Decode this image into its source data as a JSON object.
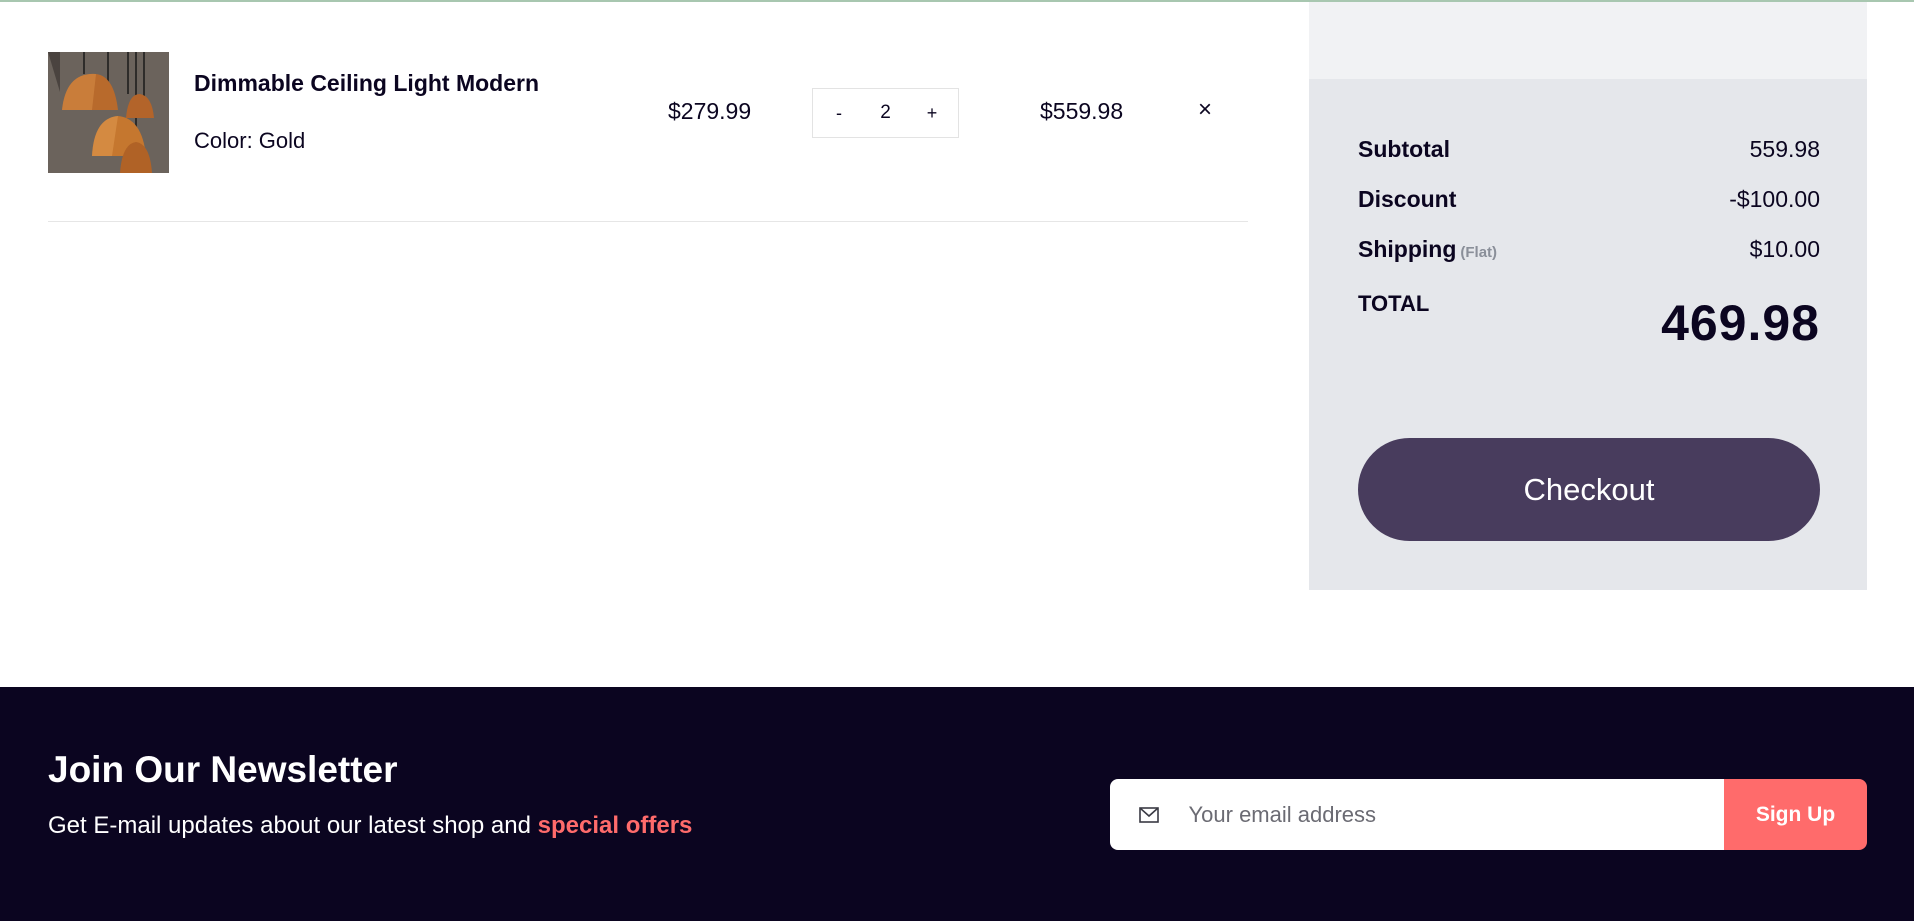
{
  "cart": {
    "item": {
      "name": "Dimmable Ceiling Light Modern",
      "color": "Color: Gold",
      "unit_price": "$279.99",
      "quantity": "2",
      "line_total": "$559.98",
      "decrement_label": "-",
      "increment_label": "+",
      "remove_label": "×",
      "image_icon": "pendant-lamps-photo"
    }
  },
  "summary": {
    "subtotal_label": "Subtotal",
    "subtotal_value": "559.98",
    "discount_label": "Discount",
    "discount_value": "-$100.00",
    "shipping_label": "Shipping",
    "shipping_note": "(Flat)",
    "shipping_value": "$10.00",
    "total_label": "TOTAL",
    "total_value": "469.98",
    "checkout_label": "Checkout"
  },
  "newsletter": {
    "title": "Join Our Newsletter",
    "text": "Get E-mail updates about our latest shop and ",
    "highlight": "special offers",
    "placeholder": "Your email address",
    "email_icon": "mail-icon",
    "signup_label": "Sign Up"
  },
  "colors": {
    "footer_bg": "#0b0520",
    "accent": "#ff6b6b",
    "checkout_bg": "#483c5d",
    "summary_bg": "#e5e7eb"
  }
}
